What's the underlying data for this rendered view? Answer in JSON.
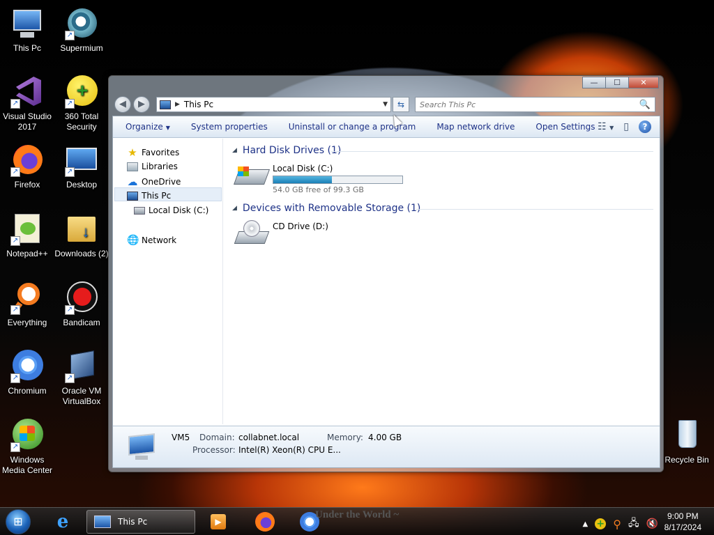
{
  "desktop": {
    "icons": [
      {
        "label": "This Pc",
        "icon": "computer-icon"
      },
      {
        "label": "Supermium",
        "icon": "supermium-icon"
      },
      {
        "label": "Visual Studio 2017",
        "icon": "visual-studio-icon"
      },
      {
        "label": "360 Total Security",
        "icon": "security-icon"
      },
      {
        "label": "Firefox",
        "icon": "firefox-icon"
      },
      {
        "label": "Desktop",
        "icon": "desktop-icon"
      },
      {
        "label": "Notepad++",
        "icon": "notepad-icon"
      },
      {
        "label": "Downloads (2)",
        "icon": "folder-icon"
      },
      {
        "label": "Everything",
        "icon": "search-tool-icon"
      },
      {
        "label": "Bandicam",
        "icon": "record-icon"
      },
      {
        "label": "Chromium",
        "icon": "chromium-icon"
      },
      {
        "label": "Oracle VM VirtualBox",
        "icon": "virtualbox-icon"
      },
      {
        "label": "Windows Media Center",
        "icon": "media-center-icon"
      },
      {
        "label": "Recycle Bin",
        "icon": "recycle-bin-icon"
      }
    ]
  },
  "window": {
    "caption_buttons": {
      "minimize": "—",
      "maximize": "☐",
      "close": "✕"
    },
    "address": {
      "path": "This Pc",
      "back": "◀",
      "forward": "▶",
      "refresh": "⇆"
    },
    "search": {
      "placeholder": "Search This Pc",
      "icon": "🔍"
    },
    "toolbar": {
      "organize": "Organize",
      "system_properties": "System properties",
      "uninstall": "Uninstall or change a program",
      "map_drive": "Map network drive",
      "open_settings": "Open Settings",
      "view_icon": "☷",
      "preview_icon": "▯",
      "help_icon": "?"
    },
    "nav": {
      "favorites": "Favorites",
      "libraries": "Libraries",
      "onedrive": "OneDrive",
      "this_pc": "This Pc",
      "local_disk": "Local Disk (C:)",
      "network": "Network"
    },
    "groups": {
      "hard_disks": "Hard Disk Drives (1)",
      "removable": "Devices with Removable Storage (1)"
    },
    "drives": {
      "c_name": "Local Disk (C:)",
      "c_free": "54.0 GB free of 99.3 GB",
      "c_used_fraction": 0.456,
      "d_name": "CD Drive (D:)"
    },
    "details": {
      "computer_name": "VM5",
      "domain_label": "Domain:",
      "domain_value": "collabnet.local",
      "memory_label": "Memory:",
      "memory_value": "4.00 GB",
      "processor_label": "Processor:",
      "processor_value": "Intel(R) Xeon(R) CPU E..."
    }
  },
  "taskbar": {
    "task_label": "This Pc",
    "wallpaper_text": "Under the World ~",
    "clock_time": "9:00 PM",
    "clock_date": "8/17/2024",
    "tray_icons": [
      "up-arrow-icon",
      "security-tray-icon",
      "search-tray-icon",
      "network-icon",
      "volume-muted-icon"
    ]
  },
  "colors": {
    "accent": "#1e3287",
    "capacity_fill": "#1a7fb7"
  }
}
